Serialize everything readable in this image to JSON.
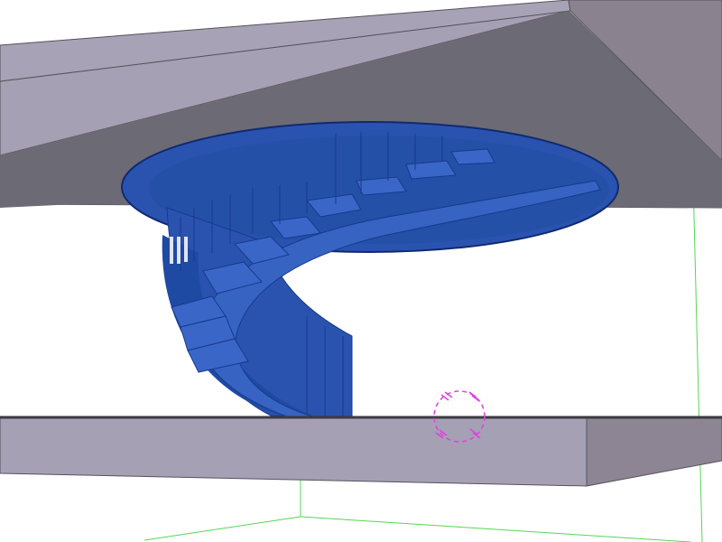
{
  "viewport": {
    "kind": "3d-model-view",
    "background": "#ffffff"
  },
  "colors": {
    "slab_top": "#a49fb2",
    "slab_side": "#6c6a75",
    "slab_edge": "#55525c",
    "stair_blue": "#2a53b0",
    "stair_blue_dark": "#173a8c",
    "stair_blue_light": "#3a66c8",
    "axis_green": "#55d655",
    "cursor_magenta": "#e040e0"
  },
  "objects": {
    "upper_slab": "floor-slab",
    "spiral_stair": "spiral-staircase",
    "lower_slab": "floor-slab",
    "stair_opening": "circular-slab-opening"
  },
  "overlays": {
    "snap_cursor": "circle-snap-marker",
    "axes": "green-axis-guides"
  }
}
